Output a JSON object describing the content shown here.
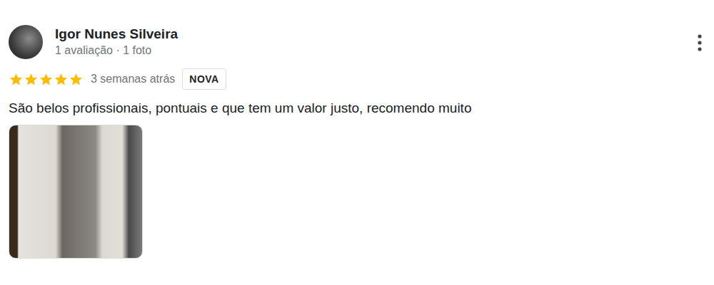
{
  "review": {
    "author": {
      "name": "Igor Nunes Silveira",
      "meta": "1 avaliação · 1 foto"
    },
    "stars": 5,
    "time": "3 semanas atrás",
    "badge": "NOVA",
    "text": "São belos profissionais, pontuais e que tem um valor justo, recomendo muito",
    "photos": 1
  }
}
